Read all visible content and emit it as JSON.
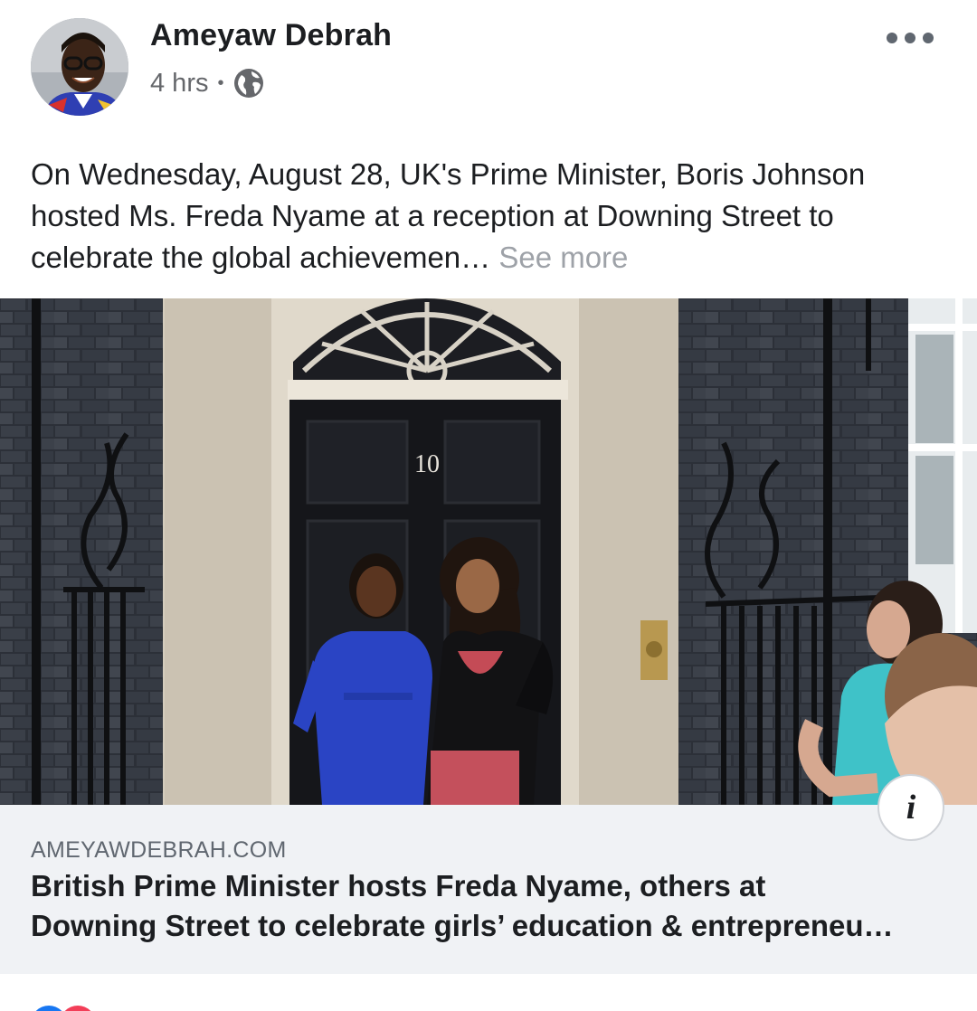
{
  "post": {
    "author": "Ameyaw Debrah",
    "timestamp": "4 hrs",
    "separator": "•",
    "privacy_icon": "globe-icon",
    "more_icon": "more-horizontal-icon",
    "text": "On Wednesday, August 28, UK's Prime Minister, Boris Johnson hosted Ms. Freda Nyame at a reception at Downing Street to celebrate the global achievemen…",
    "see_more": "See more"
  },
  "photo": {
    "door_number": "10"
  },
  "link": {
    "domain": "AMEYAWDEBRAH.COM",
    "title": "British Prime Minister hosts Freda Nyame, others at\nDowning Street to celebrate girls’ education & entrepreneu…",
    "info_icon": "info-icon",
    "info_glyph": "i"
  },
  "reactions": {
    "icons": [
      "like-icon",
      "love-icon"
    ]
  },
  "colors": {
    "text": "#1c1e21",
    "secondary": "#65676b",
    "see_more": "#9ea2a8",
    "link_bg": "#f0f2f5",
    "like": "#1877f2",
    "love": "#f33e58"
  }
}
